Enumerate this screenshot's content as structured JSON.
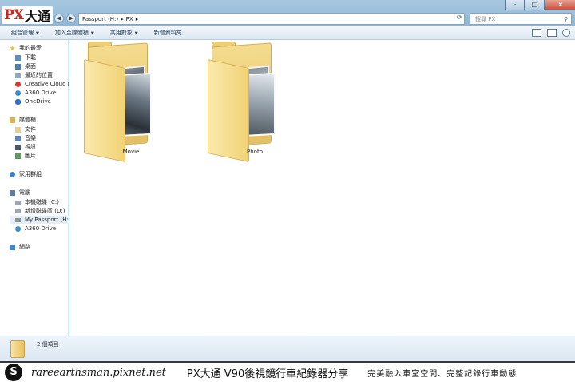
{
  "window": {
    "logo_px": "PX",
    "logo_cn": "大通",
    "minimize": "–",
    "maximize": "□",
    "close": "x"
  },
  "address": {
    "segment1": "Passport (H:)",
    "sep1": "▸",
    "segment2": "PX",
    "sep2": "▸"
  },
  "search": {
    "placeholder": "搜尋 PX"
  },
  "toolbar": {
    "organize": "組合管理",
    "add_to_library": "加入至媒體櫃",
    "share_with": "共用對象",
    "new_folder": "新增資料夾"
  },
  "sidebar": {
    "favorites_header": "我的最愛",
    "favorites": [
      "下載",
      "桌面",
      "最近的位置",
      "Creative Cloud File",
      "A360 Drive",
      "OneDrive"
    ],
    "libraries_header": "媒體櫃",
    "libraries": [
      "文件",
      "音樂",
      "視訊",
      "圖片"
    ],
    "homegroup": "家用群組",
    "computer_header": "電腦",
    "drives": [
      "本機磁碟 (C:)",
      "新增磁碟區 (D:)",
      "My Passport (H:)",
      "A360 Drive"
    ],
    "network": "網路"
  },
  "folders": [
    {
      "name": "Movie"
    },
    {
      "name": "Photo"
    }
  ],
  "status": {
    "item_count": "2 個項目"
  },
  "banner": {
    "url": "rareearthsman.pixnet.net",
    "headline": "PX大通 V90後視鏡行車紀錄器分享",
    "slogan": "完美融入車室空間、完整記錄行車動態"
  },
  "colors": {
    "window_frame": "#8fb6d4",
    "folder_yellow": "#f1d275",
    "logo_red": "#d2261c"
  }
}
